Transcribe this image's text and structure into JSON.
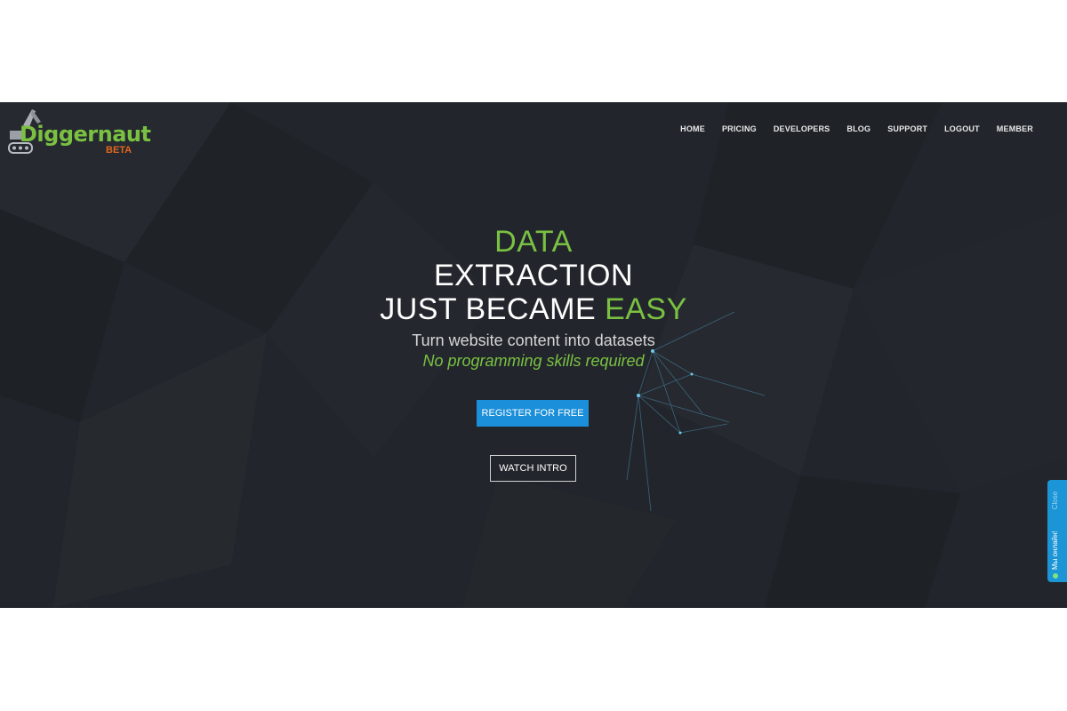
{
  "brand": {
    "name": "Diggernaut",
    "badge": "BETA",
    "logo_icon": "excavator-icon"
  },
  "nav": {
    "items": [
      {
        "label": "HOME"
      },
      {
        "label": "PRICING"
      },
      {
        "label": "DEVELOPERS"
      },
      {
        "label": "BLOG"
      },
      {
        "label": "SUPPORT"
      },
      {
        "label": "LOGOUT"
      },
      {
        "label": "MEMBER"
      }
    ]
  },
  "hero": {
    "line1": "DATA",
    "line2": "EXTRACTION",
    "line3_start": "JUST BECAME ",
    "line3_accent": "EASY",
    "subtitle": "Turn website content into datasets",
    "tagline": "No programming skills required"
  },
  "buttons": {
    "register": "REGISTER FOR FREE",
    "watch": "WATCH INTRO"
  },
  "chat": {
    "label": "Мы онлайн!",
    "close": "Close"
  },
  "colors": {
    "background": "#22262c",
    "accent_green": "#7ac142",
    "accent_orange": "#e2661e",
    "button_blue": "#1b8fd9"
  }
}
